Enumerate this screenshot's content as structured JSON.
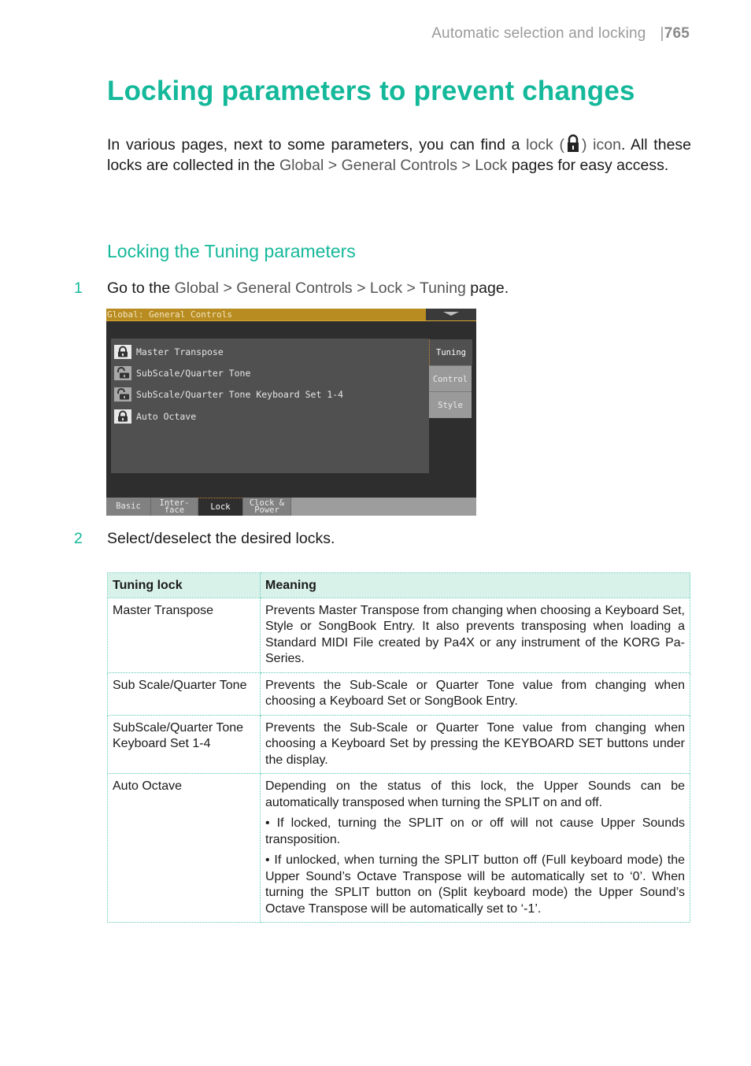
{
  "running_head": {
    "section": "Automatic selection and locking",
    "page_number": "765"
  },
  "title": "Locking parameters to prevent changes",
  "intro": {
    "t1": "In various pages, next to some parameters, you can find a ",
    "lock_word": "lock (",
    "lock_icon": "lock-icon",
    "icon_word": ") icon",
    "t2": ". All these locks are collected in the ",
    "path1": "Global",
    "sep": " > ",
    "path2": "General Controls",
    "path3": "Lock",
    "t3": " pages for easy access."
  },
  "subtitle": "Locking the Tuning parameters",
  "steps": [
    {
      "num": "1",
      "prefix": "Go to the ",
      "path": [
        "Global",
        "General Controls",
        "Lock",
        "Tuning"
      ],
      "suffix": " page."
    },
    {
      "num": "2",
      "text": "Select/deselect the desired locks."
    }
  ],
  "screen": {
    "title": "Global: General Controls",
    "rows": [
      {
        "label": "Master Transpose",
        "locked": true
      },
      {
        "label": "SubScale/Quarter Tone",
        "locked": false
      },
      {
        "label": "SubScale/Quarter Tone Keyboard Set 1-4",
        "locked": false
      },
      {
        "label": "Auto Octave",
        "locked": true
      }
    ],
    "side_tabs": [
      "Tuning",
      "Control",
      "Style"
    ],
    "active_side_tab": "Tuning",
    "bottom_tabs": [
      {
        "l1": "Basic",
        "l2": ""
      },
      {
        "l1": "Inter-",
        "l2": "face"
      },
      {
        "l1": "Lock",
        "l2": ""
      },
      {
        "l1": "Clock &",
        "l2": "Power"
      }
    ],
    "active_bottom_tab": "Lock"
  },
  "table": {
    "headers": [
      "Tuning lock",
      "Meaning"
    ],
    "rows": [
      {
        "lock": "Master Transpose",
        "meaning": [
          "Prevents Master Transpose from changing when choosing a Keyboard Set, Style or SongBook Entry. It also prevents transposing when loading a Standard MIDI File created by Pa4X or any instrument of the KORG Pa-Series."
        ]
      },
      {
        "lock": "Sub Scale/Quarter Tone",
        "meaning": [
          "Prevents the Sub-Scale or Quarter Tone value from changing when choosing a Keyboard Set or SongBook Entry."
        ]
      },
      {
        "lock": "SubScale/Quarter Tone Keyboard Set 1-4",
        "meaning": [
          "Prevents the Sub-Scale or Quarter Tone value from changing when choosing a Keyboard Set by pressing the KEYBOARD SET buttons under the display."
        ]
      },
      {
        "lock": "Auto Octave",
        "meaning": [
          "Depending on the status of this lock, the Upper Sounds can be automatically transposed when turning the SPLIT on and off.",
          "• If locked, turning the SPLIT on or off will not cause Upper Sounds transposition.",
          "• If unlocked, when turning the SPLIT button off (Full keyboard mode) the Upper Sound’s Octave Transpose will be automatically set to ‘0’. When turning the SPLIT button on (Split keyboard mode) the Upper Sound’s Octave Transpose will be automatically set to ‘-1’."
        ]
      }
    ]
  },
  "colors": {
    "accent": "#14b89a",
    "ui_path": "#555555",
    "table_header_bg": "#d8f2ea",
    "screen_title_bar": "#b98c22"
  }
}
